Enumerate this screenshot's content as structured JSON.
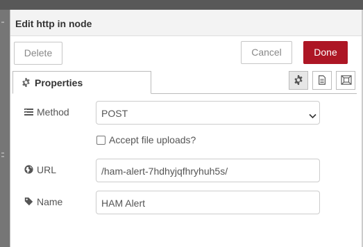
{
  "dialog": {
    "title": "Edit http in node",
    "delete_label": "Delete",
    "cancel_label": "Cancel",
    "done_label": "Done",
    "accent_color": "#ad1625"
  },
  "tabs": {
    "properties_label": "Properties",
    "side_buttons": [
      "gear-icon",
      "document-icon",
      "frame-icon"
    ]
  },
  "form": {
    "method": {
      "label": "Method",
      "value": "POST",
      "icon": "list-icon"
    },
    "accept_uploads": {
      "label": "Accept file uploads?",
      "checked": false
    },
    "url": {
      "label": "URL",
      "value": "/ham-alert-7hdhyjqfhryhuh5s/",
      "icon": "globe-icon"
    },
    "name": {
      "label": "Name",
      "value": "HAM Alert",
      "icon": "tag-icon"
    }
  }
}
